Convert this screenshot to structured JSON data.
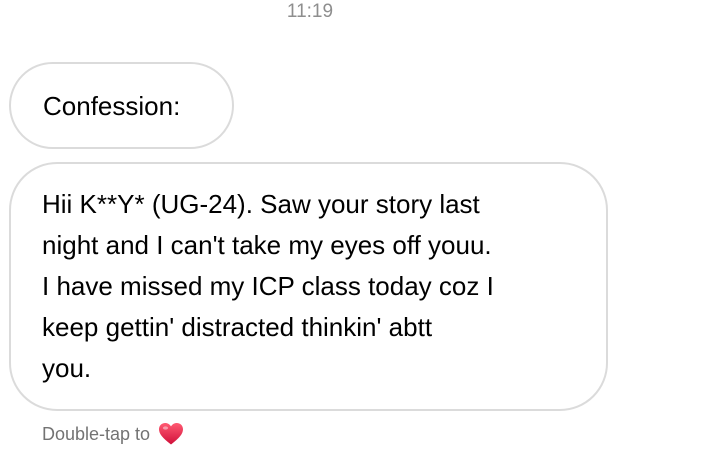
{
  "thread": {
    "timestamp": "11:19",
    "messages": [
      {
        "lines": [
          "Confession:"
        ]
      },
      {
        "lines": [
          "Hii K**Y* (UG-24). Saw your story last",
          "night and I can't take my eyes off youu.",
          "I have missed my ICP class today coz I",
          "keep gettin' distracted thinkin' abtt",
          "you."
        ]
      }
    ],
    "hint": {
      "text": "Double-tap to",
      "icon": "red-heart-icon"
    }
  },
  "colors": {
    "bubble_border": "#dbdbdb",
    "timestamp_text": "#8e8e8e",
    "hint_text": "#737373",
    "heart": "#e0245e"
  }
}
